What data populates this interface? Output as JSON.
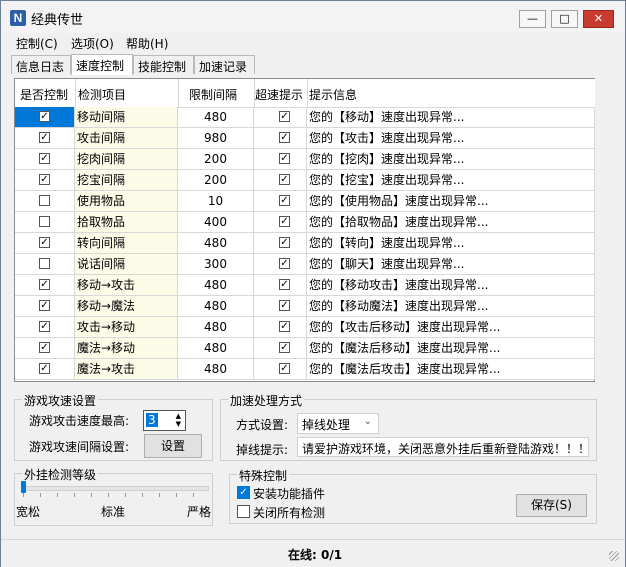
{
  "window": {
    "title": "经典传世",
    "app_icon_glyph": "N",
    "min_glyph": "—",
    "max_glyph": "□",
    "close_glyph": "✕"
  },
  "menu": [
    "控制(C)",
    "选项(O)",
    "帮助(H)"
  ],
  "tabs": [
    "信息日志",
    "速度控制",
    "技能控制",
    "加速记录"
  ],
  "active_tab": "速度控制",
  "table": {
    "headers": [
      "是否控制",
      "检测项目",
      "限制间隔",
      "超速提示",
      "提示信息"
    ],
    "rows": [
      {
        "control": true,
        "item": "移动间隔",
        "limit": "480",
        "warn": true,
        "message": "您的【移动】速度出现异常..."
      },
      {
        "control": true,
        "item": "攻击间隔",
        "limit": "980",
        "warn": true,
        "message": "您的【攻击】速度出现异常..."
      },
      {
        "control": true,
        "item": "挖肉间隔",
        "limit": "200",
        "warn": true,
        "message": "您的【挖肉】速度出现异常..."
      },
      {
        "control": true,
        "item": "挖宝间隔",
        "limit": "200",
        "warn": true,
        "message": "您的【挖宝】速度出现异常..."
      },
      {
        "control": false,
        "item": "使用物品",
        "limit": "10",
        "warn": true,
        "message": "您的【使用物品】速度出现异常..."
      },
      {
        "control": false,
        "item": "拾取物品",
        "limit": "400",
        "warn": true,
        "message": "您的【拾取物品】速度出现异常..."
      },
      {
        "control": true,
        "item": "转向间隔",
        "limit": "480",
        "warn": true,
        "message": "您的【转向】速度出现异常..."
      },
      {
        "control": false,
        "item": "说话间隔",
        "limit": "300",
        "warn": true,
        "message": "您的【聊天】速度出现异常..."
      },
      {
        "control": true,
        "item": "移动→攻击",
        "limit": "480",
        "warn": true,
        "message": "您的【移动攻击】速度出现异常..."
      },
      {
        "control": true,
        "item": "移动→魔法",
        "limit": "480",
        "warn": true,
        "message": "您的【移动魔法】速度出现异常..."
      },
      {
        "control": true,
        "item": "攻击→移动",
        "limit": "480",
        "warn": true,
        "message": "您的【攻击后移动】速度出现异常..."
      },
      {
        "control": true,
        "item": "魔法→移动",
        "limit": "480",
        "warn": true,
        "message": "您的【魔法后移动】速度出现异常..."
      },
      {
        "control": true,
        "item": "魔法→攻击",
        "limit": "480",
        "warn": true,
        "message": "您的【魔法后攻击】速度出现异常..."
      }
    ]
  },
  "game_speed": {
    "title": "游戏攻速设置",
    "max_label": "游戏攻击速度最高:",
    "max_value": "3",
    "interval_label": "游戏攻速间隔设置:",
    "set_button": "设置"
  },
  "accel": {
    "title": "加速处理方式",
    "method_label": "方式设置:",
    "method_value": "掉线处理",
    "kick_label": "掉线提示:",
    "kick_text": "请爱护游戏环境，关闭恶意外挂后重新登陆游戏！！！"
  },
  "detect_level": {
    "title": "外挂检测等级",
    "labels": [
      "宽松",
      "标准",
      "严格"
    ],
    "level_fraction": 0
  },
  "special": {
    "title": "特殊控制",
    "install_plugin": "安装功能插件",
    "install_checked": true,
    "close_all": "关闭所有检测",
    "close_all_checked": false,
    "save_button": "保存(S)"
  },
  "status": {
    "online": "在线: 0/1"
  },
  "colors": {
    "accent": "#0078d7",
    "item_col_bg": "#fbfbe8"
  }
}
